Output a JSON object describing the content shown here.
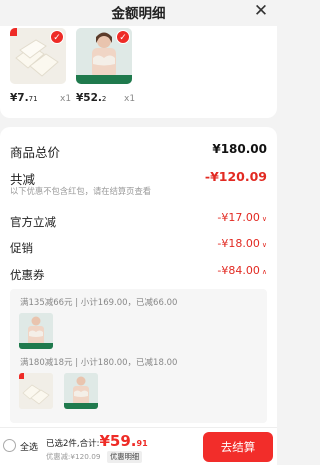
{
  "header": {
    "title": "金额明细",
    "close_icon": "close-icon"
  },
  "products": [
    {
      "price_int": "¥7.",
      "price_dec": "71",
      "qty": "x1"
    },
    {
      "price_int": "¥52.",
      "price_dec": "2",
      "qty": "x1"
    }
  ],
  "summary": {
    "goods_total_label": "商品总价",
    "goods_total_value": "¥180.00",
    "discount_total_label": "共减",
    "discount_total_value": "-¥120.09",
    "discount_note": "以下优惠不包含红包，请在结算页查看",
    "official_label": "官方立减",
    "official_value": "-¥17.00",
    "promo_label": "促销",
    "promo_value": "-¥18.00",
    "coupon_label": "优惠券",
    "coupon_value": "-¥84.00"
  },
  "coupon_groups": [
    {
      "text": "满135减66元 | 小计169.00，已减66.00"
    },
    {
      "text": "满180减18元 | 小计180.00，已减18.00"
    }
  ],
  "bottom": {
    "select_all": "全选",
    "selected_text": "已选2件,合计:",
    "total_int": "¥59.",
    "total_dec": "91",
    "discount_text": "优惠减:¥120.09",
    "detail_label": "优惠明细",
    "checkout_label": "去结算"
  },
  "colors": {
    "accent": "#ee2b26",
    "product_strip": "#1f7a4d"
  }
}
